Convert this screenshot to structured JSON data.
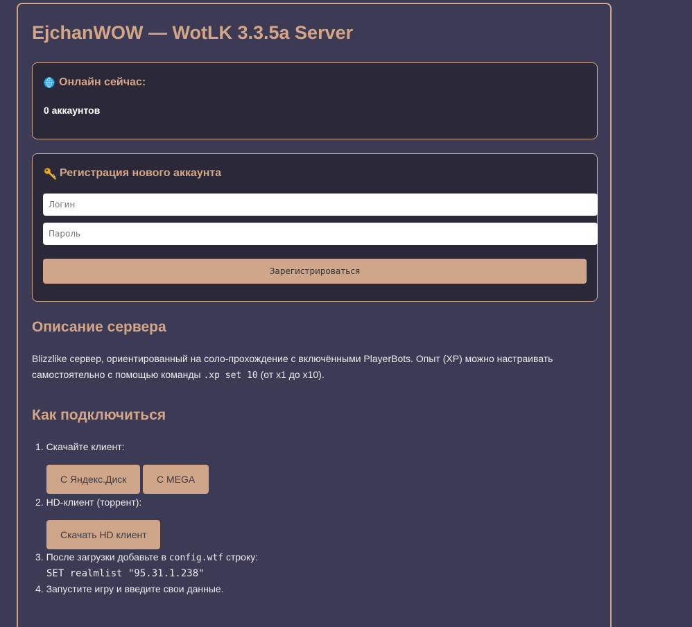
{
  "header": {
    "title": "EjchanWOW — WotLK 3.3.5a Server"
  },
  "online": {
    "icon": "globe-icon",
    "heading": "Онлайн сейчас:",
    "count_text": "0 аккаунтов"
  },
  "register": {
    "icon": "key-icon",
    "heading": "Регистрация нового аккаунта",
    "login_placeholder": "Логин",
    "login_value": "",
    "password_placeholder": "Пароль",
    "password_value": "",
    "submit_label": "Зарегистрироваться"
  },
  "description": {
    "title": "Описание сервера",
    "text_before": "Blizzlike сервер, ориентированный на соло-прохождение с включёнными PlayerBots. Опыт (XP) можно настраивать самостоятельно с помощью команды ",
    "command": ".xp set 10",
    "text_after": " (от x1 до x10)."
  },
  "connect": {
    "title": "Как подключиться",
    "steps": {
      "s1": "1. Скачайте клиент:",
      "s1_buttons": [
        "С Яндекс.Диск",
        "С MEGA"
      ],
      "s2": "2. HD-клиент (торрент):",
      "s2_button": "Скачать HD клиент",
      "s3_before": "3. После загрузки добавьте в ",
      "s3_file": "config.wtf",
      "s3_after": " строку:",
      "s3_code": "SET realmlist \"95.31.1.238\"",
      "s4": "4. Запустите игру и введите свои данные."
    }
  },
  "colors": {
    "background": "#3d3a55",
    "card": "#2a2839",
    "accent": "#cfa689",
    "heading": "#d4a685"
  }
}
